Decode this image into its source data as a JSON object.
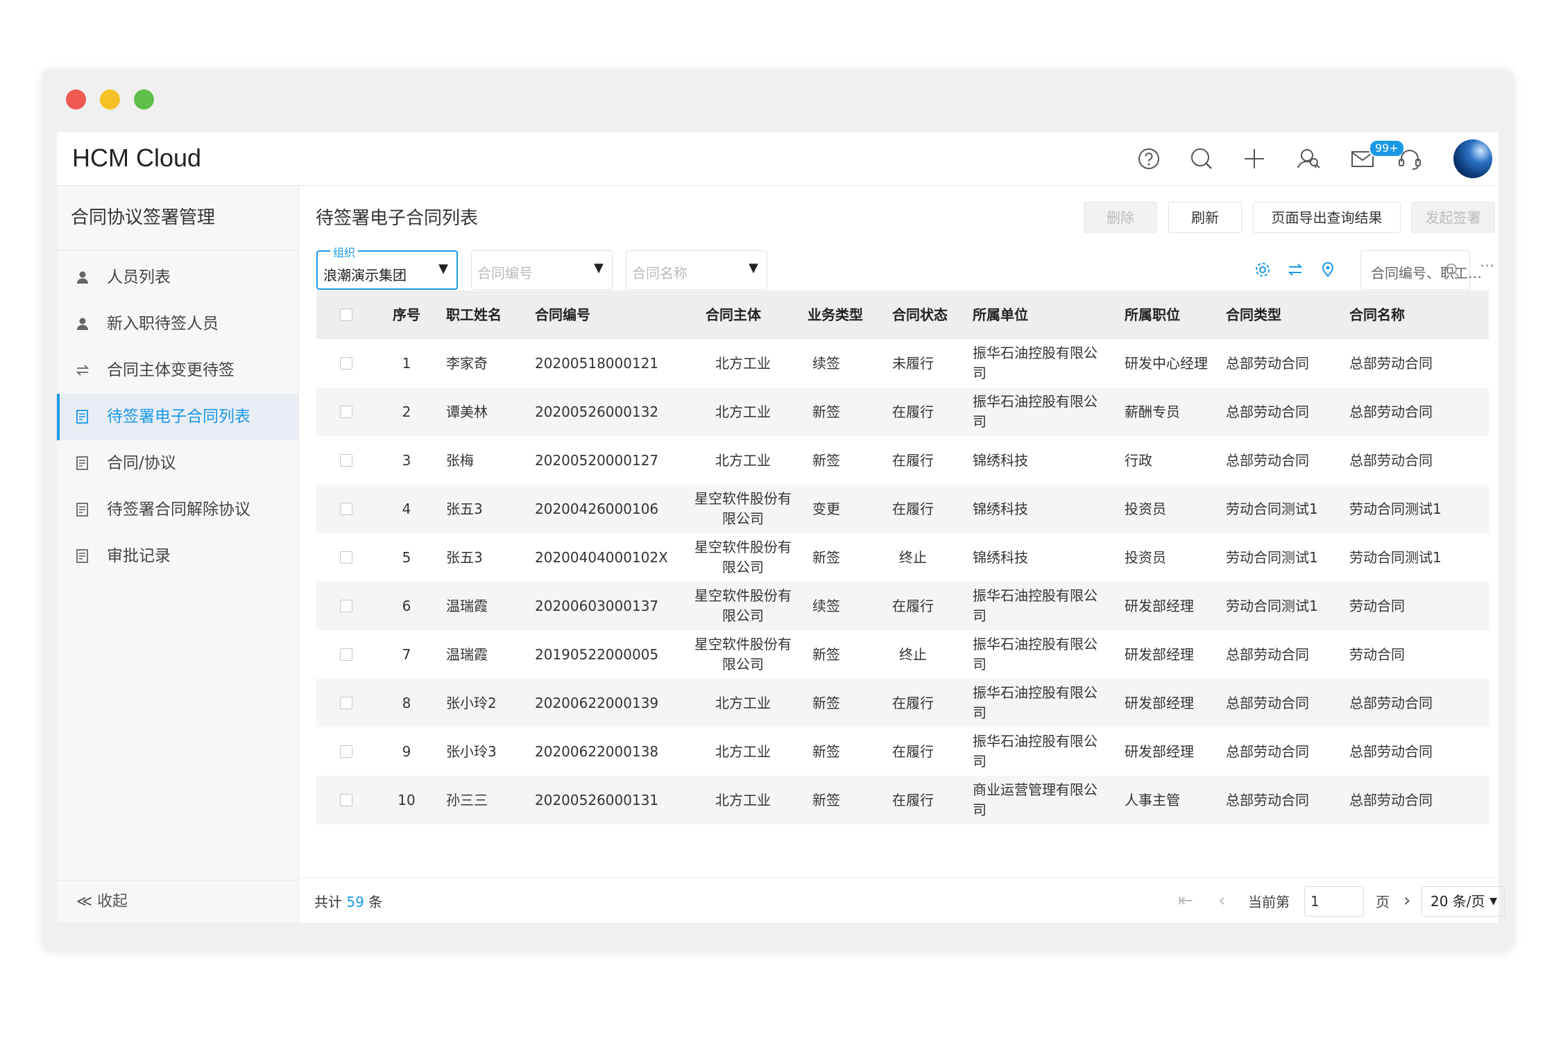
{
  "app": {
    "title": "HCM Cloud",
    "notification_count": "99+"
  },
  "sidebar": {
    "title": "合同协议签署管理",
    "items": [
      {
        "label": "人员列表",
        "icon": "user-icon"
      },
      {
        "label": "新入职待签人员",
        "icon": "user-icon"
      },
      {
        "label": "合同主体变更待签",
        "icon": "swap-icon"
      },
      {
        "label": "待签署电子合同列表",
        "icon": "document-icon",
        "active": true
      },
      {
        "label": "合同/协议",
        "icon": "document-icon"
      },
      {
        "label": "待签署合同解除协议",
        "icon": "document-icon"
      },
      {
        "label": "审批记录",
        "icon": "document-icon"
      }
    ],
    "collapse_label": "≪ 收起"
  },
  "main": {
    "title": "待签署电子合同列表",
    "buttons": {
      "delete": "删除",
      "refresh": "刷新",
      "export": "页面导出查询结果",
      "sign": "发起签署"
    },
    "filters": {
      "org_label": "组织",
      "org_value": "浪潮演示集团",
      "contract_no_placeholder": "合同编号",
      "contract_name_placeholder": "合同名称"
    },
    "search_placeholder": "合同编号、职工…",
    "columns": [
      "序号",
      "职工姓名",
      "合同编号",
      "合同主体",
      "业务类型",
      "合同状态",
      "所属单位",
      "所属职位",
      "合同类型",
      "合同名称"
    ],
    "rows": [
      [
        "1",
        "李家奇",
        "20200518000121",
        "北方工业",
        "续签",
        "未履行",
        "振华石油控股有限公司",
        "研发中心经理",
        "总部劳动合同",
        "总部劳动合同"
      ],
      [
        "2",
        "谭美林",
        "20200526000132",
        "北方工业",
        "新签",
        "在履行",
        "振华石油控股有限公司",
        "薪酬专员",
        "总部劳动合同",
        "总部劳动合同"
      ],
      [
        "3",
        "张梅",
        "20200520000127",
        "北方工业",
        "新签",
        "在履行",
        "锦绣科技",
        "行政",
        "总部劳动合同",
        "总部劳动合同"
      ],
      [
        "4",
        "张五3",
        "20200426000106",
        "星空软件股份有限公司",
        "变更",
        "在履行",
        "锦绣科技",
        "投资员",
        "劳动合同测试1",
        "劳动合同测试1"
      ],
      [
        "5",
        "张五3",
        "20200404000102X",
        "星空软件股份有限公司",
        "新签",
        "终止",
        "锦绣科技",
        "投资员",
        "劳动合同测试1",
        "劳动合同测试1"
      ],
      [
        "6",
        "温瑞霞",
        "20200603000137",
        "星空软件股份有限公司",
        "续签",
        "在履行",
        "振华石油控股有限公司",
        "研发部经理",
        "劳动合同测试1",
        "劳动合同"
      ],
      [
        "7",
        "温瑞霞",
        "20190522000005",
        "星空软件股份有限公司",
        "新签",
        "终止",
        "振华石油控股有限公司",
        "研发部经理",
        "总部劳动合同",
        "劳动合同"
      ],
      [
        "8",
        "张小玲2",
        "20200622000139",
        "北方工业",
        "新签",
        "在履行",
        "振华石油控股有限公司",
        "研发部经理",
        "总部劳动合同",
        "总部劳动合同"
      ],
      [
        "9",
        "张小玲3",
        "20200622000138",
        "北方工业",
        "新签",
        "在履行",
        "振华石油控股有限公司",
        "研发部经理",
        "总部劳动合同",
        "总部劳动合同"
      ],
      [
        "10",
        "孙三三",
        "20200526000131",
        "北方工业",
        "新签",
        "在履行",
        "商业运营管理有限公司",
        "人事主管",
        "总部劳动合同",
        "总部劳动合同"
      ]
    ],
    "footer": {
      "total_prefix": "共计",
      "total_count": "59",
      "total_suffix": "条",
      "current_page_label": "当前第",
      "current_page": "1",
      "page_suffix": "页",
      "page_size": "20 条/页"
    }
  },
  "colors": {
    "accent": "#1a98e8"
  }
}
